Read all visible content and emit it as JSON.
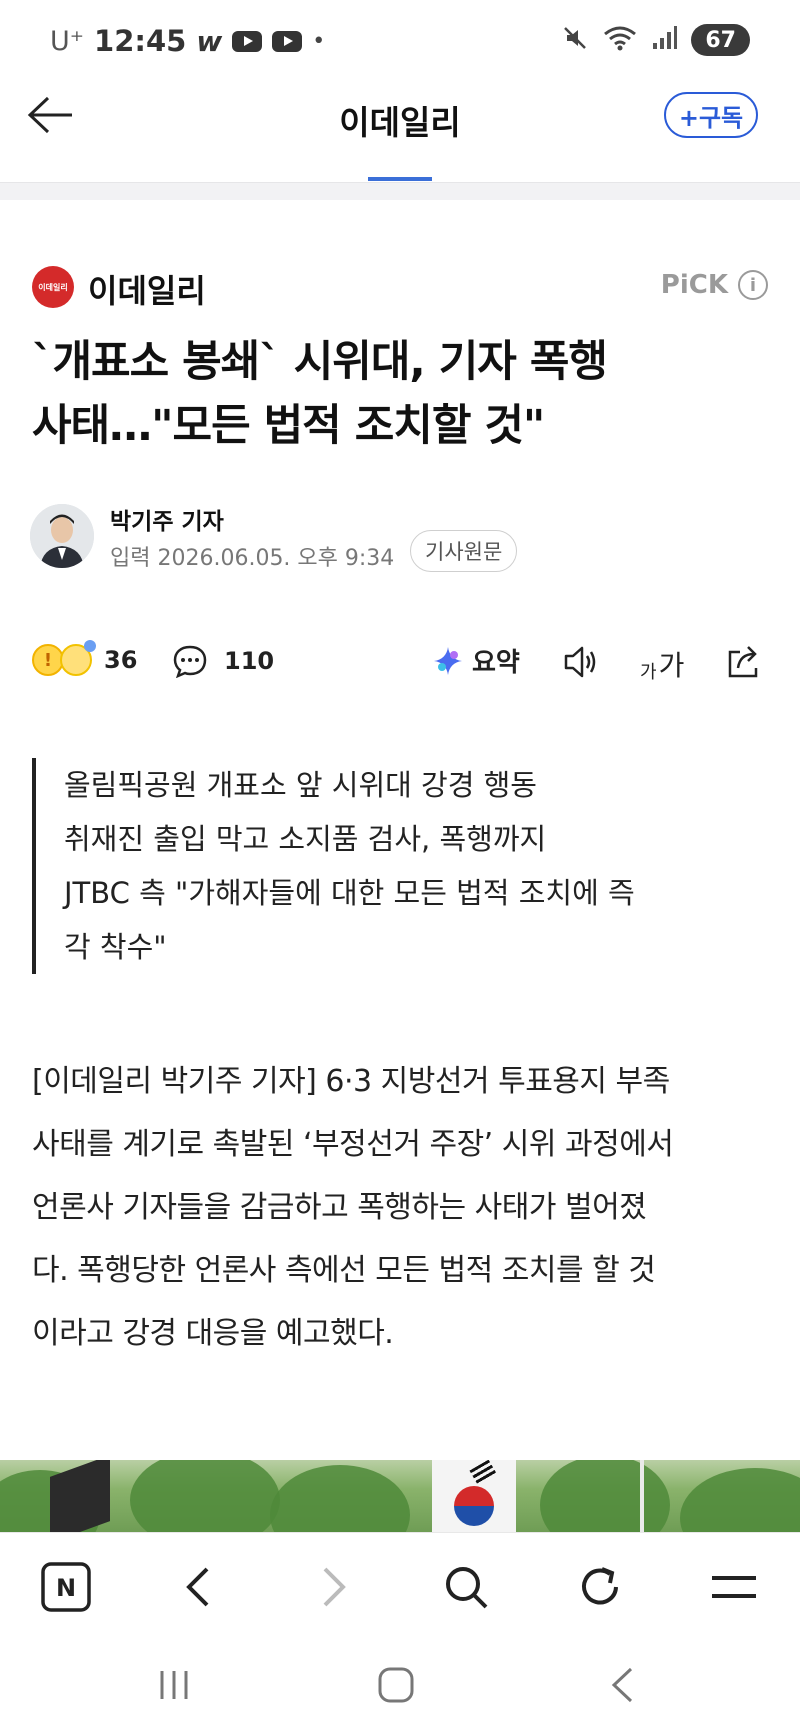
{
  "status_bar": {
    "carrier": "U⁺",
    "time": "12:45",
    "app_letter": "w",
    "dot": "•",
    "battery": "67"
  },
  "app_bar": {
    "title": "이데일리",
    "subscribe_label": "+구독"
  },
  "press": {
    "logo_text": "이데일리",
    "name": "이데일리",
    "pick_label": "PiCK",
    "info_glyph": "i"
  },
  "article": {
    "headline_line1": "`개표소 봉쇄` 시위대, 기자 폭행",
    "headline_line2": "사태…\"모든 법적 조치할 것\"",
    "reporter": "박기주 기자",
    "date": "입력 2026.06.05. 오후 9:34",
    "original_label": "기사원문",
    "reaction_count": "36",
    "comment_count": "110",
    "summary_label": "요약",
    "font_size_label_small": "가",
    "font_size_label_large": "가",
    "summary_lines": [
      "올림픽공원 개표소 앞 시위대 강경 행동",
      "취재진 출입 막고 소지품 검사, 폭행까지",
      "JTBC 측 \"가해자들에 대한 모든 법적 조치에 즉",
      "각 착수\""
    ],
    "body_lines": [
      "[이데일리 박기주 기자] 6·3 지방선거 투표용지 부족",
      "사태를 계기로 촉발된 ‘부정선거 주장’ 시위 과정에서",
      "언론사 기자들을 감금하고 폭행하는 사태가 벌어졌",
      "다. 폭행당한 언론사 측에선 모든 법적 조치를 할 것",
      "이라고 강경 대응을 예고했다."
    ]
  },
  "browser_toolbar": {
    "home_letter": "N"
  },
  "colors": {
    "accent_blue": "#2a5bd7",
    "press_red": "#d42a2a",
    "text_dark": "#111111",
    "muted_gray": "#777777"
  },
  "icons": [
    "back-arrow-icon",
    "mute-icon",
    "wifi-icon",
    "signal-icon",
    "info-icon",
    "comment-icon",
    "ai-summary-icon",
    "speaker-icon",
    "share-icon",
    "naver-home-icon",
    "chevron-left-icon",
    "chevron-right-icon",
    "search-icon",
    "refresh-icon",
    "menu-icon",
    "recent-apps-icon",
    "home-icon",
    "system-back-icon"
  ]
}
